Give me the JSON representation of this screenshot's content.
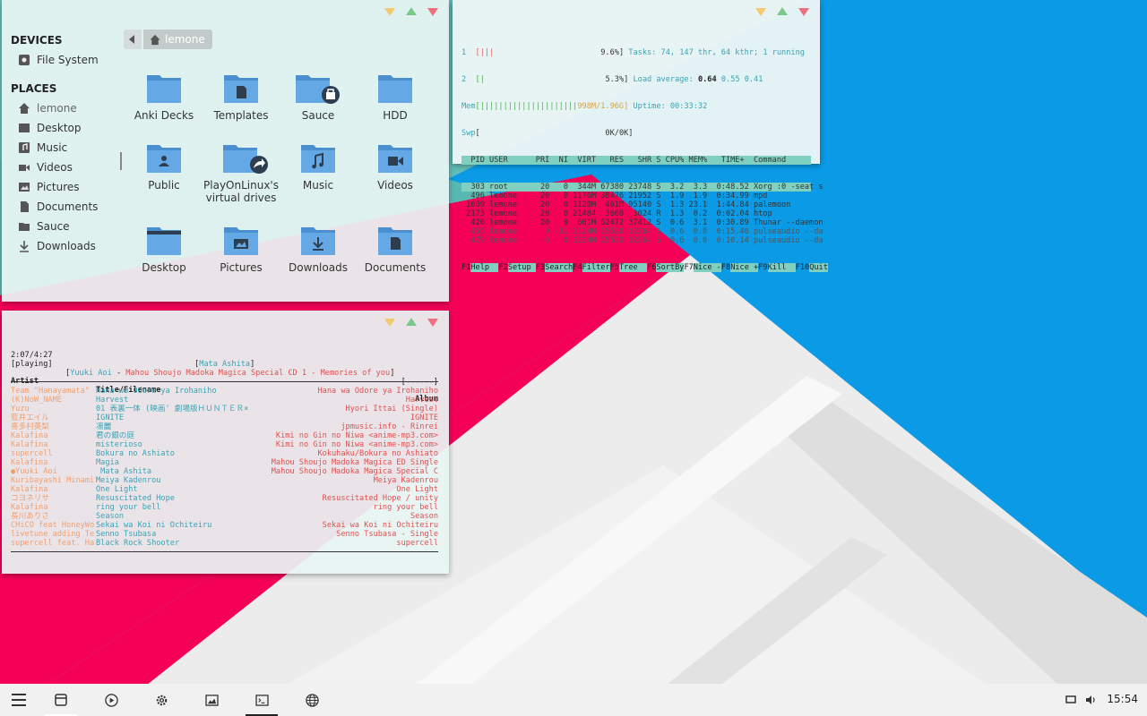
{
  "colors": {
    "accent_pink": "#f50057",
    "accent_blue": "#0a9ae6",
    "teal": "#5ab8b3",
    "term_header": "#7fd0c0"
  },
  "file_manager": {
    "sidebar": {
      "devices_title": "DEVICES",
      "devices": [
        {
          "label": "File System",
          "icon": "drive-icon"
        }
      ],
      "places_title": "PLACES",
      "places": [
        {
          "label": "lemone",
          "icon": "home-icon"
        },
        {
          "label": "Desktop",
          "icon": "desktop-icon"
        },
        {
          "label": "Music",
          "icon": "music-icon"
        },
        {
          "label": "Videos",
          "icon": "video-icon"
        },
        {
          "label": "Pictures",
          "icon": "pictures-icon"
        },
        {
          "label": "Documents",
          "icon": "documents-icon"
        },
        {
          "label": "Sauce",
          "icon": "folder-icon"
        },
        {
          "label": "Downloads",
          "icon": "download-icon"
        }
      ]
    },
    "path": {
      "current": "lemone"
    },
    "items": [
      {
        "label": "Anki Decks",
        "icon": "folder-icon"
      },
      {
        "label": "Templates",
        "icon": "templates-folder-icon"
      },
      {
        "label": "Sauce",
        "icon": "shared-folder-icon"
      },
      {
        "label": "HDD",
        "icon": "folder-icon"
      },
      {
        "label": "Public",
        "icon": "public-folder-icon"
      },
      {
        "label": "PlayOnLinux's virtual drives",
        "icon": "symlink-folder-icon"
      },
      {
        "label": "Music",
        "icon": "music-folder-icon"
      },
      {
        "label": "Videos",
        "icon": "videos-folder-icon"
      },
      {
        "label": "Desktop",
        "icon": "desktop-folder-icon"
      },
      {
        "label": "Pictures",
        "icon": "pictures-folder-icon"
      },
      {
        "label": "Downloads",
        "icon": "downloads-folder-icon"
      },
      {
        "label": "Documents",
        "icon": "documents-folder-icon"
      }
    ]
  },
  "htop": {
    "cpu1": {
      "label": "1",
      "bar": "[|||",
      "pct": "9.6%]"
    },
    "cpu2": {
      "label": "2",
      "bar": "[|",
      "pct": "5.3%]"
    },
    "mem": {
      "label": "Mem",
      "bar": "[|||||||||||||||||||||",
      "value": "998M/1.96G]"
    },
    "swp": {
      "label": "Swp",
      "bar": "[",
      "value": "0K/0K]"
    },
    "tasks": "Tasks: 74, 147 thr, 64 kthr; 1 running",
    "load_label": "Load average:",
    "load_1": "0.64",
    "load_rest": "0.55 0.41",
    "uptime": "Uptime: 00:33:32",
    "columns": "  PID USER      PRI  NI  VIRT   RES   SHR S CPU% MEM%   TIME+  Command",
    "rows": [
      "  303 root       20   0  344M 67380 23748 S  3.2  3.3  0:48.52 Xorg :0 -seat s",
      "  496 lemone     20   0 1176M 38476 21952 S  1.9  1.9  0:34.99 mpd",
      " 1609 lemone     20   0 1120M  461M 95140 S  1.3 23.1  1:44.84 palemoon",
      " 2173 lemone     20   0 21484  3660  3024 R  1.3  0.2  0:02.04 htop",
      "  426 lemone     20   0  601M 62472 37412 S  0.6  3.1  0:30.89 Thunar --daemon",
      "  455 lemone      9 -11 1124M 15520 12264 S  0.6  0.8  0:15.46 pulseaudio --da",
      "  479 lemone     -6   0 1124M 15520 12264 S  0.6  0.8  0:10.14 pulseaudio --da"
    ],
    "fkeys": [
      {
        "k": "F1",
        "v": "Help  "
      },
      {
        "k": "F2",
        "v": "Setup "
      },
      {
        "k": "F3",
        "v": "Search"
      },
      {
        "k": "F4",
        "v": "Filter"
      },
      {
        "k": "F5",
        "v": "Tree  "
      },
      {
        "k": "F6",
        "v": "SortBy"
      },
      {
        "k": "F7",
        "v": "Nice -"
      },
      {
        "k": "F8",
        "v": "Nice +"
      },
      {
        "k": "F9",
        "v": "Kill  "
      },
      {
        "k": "F10",
        "v": "Quit"
      }
    ]
  },
  "cmus": {
    "time": "2:07/4:27",
    "status": "[playing]",
    "title_center": "Mata Ashita",
    "now_artist": "Yuuki Aoi",
    "now_dash": " - ",
    "now_album": "Mahou Shoujo Madoka Magica Special CD 1 - Memories of you",
    "flags": "[------]",
    "head_artist": "Artist",
    "head_title": "Title/Filename",
    "head_album": "Album",
    "rows": [
      {
        "a": "Team \"Hanayamata\"",
        "t": "Hana wa Odore ya Irohaniho",
        "al": "Hana wa Odore ya Irohaniho"
      },
      {
        "a": "(K)NoW_NAME",
        "t": "Harvest",
        "al": "Harvest"
      },
      {
        "a": "Yuzu",
        "t": "01 表裏一体 (映画' 劇場版ＨＵＮＴＥＲ×",
        "al": "Hyori Ittai (Single)"
      },
      {
        "a": "藍井エイル",
        "t": "IGNITE",
        "al": "IGNITE"
      },
      {
        "a": "喜多村英梨",
        "t": "凛麗",
        "al": "jpmusic.info - Rinrei"
      },
      {
        "a": "Kalafina",
        "t": "君の銀の庭",
        "al": "Kimi no Gin no Niwa <anime-mp3.com>"
      },
      {
        "a": "Kalafina",
        "t": "misterioso",
        "al": "Kimi no Gin no Niwa <anime-mp3.com>"
      },
      {
        "a": "supercell",
        "t": "Bokura no Ashiato",
        "al": "Kokuhaku/Bokura no Ashiato"
      },
      {
        "a": "Kalafina",
        "t": "Magia",
        "al": "Mahou Shoujo Madoka Magica ED Single"
      },
      {
        "a": "●Yuuki Aoi",
        "t": " Mata Ashita",
        "al": "Mahou Shoujo Madoka Magica Special C",
        "cur": true
      },
      {
        "a": "Kuribayashi Minami",
        "t": "Meiya Kadenrou",
        "al": "Meiya Kadenrou"
      },
      {
        "a": "Kalafina",
        "t": "One Light",
        "al": "One Light"
      },
      {
        "a": "コヨネリサ",
        "t": "Resuscitated Hope",
        "al": "Resuscitated Hope / unity"
      },
      {
        "a": "Kalafina",
        "t": "ring your bell",
        "al": "ring your bell"
      },
      {
        "a": "長川ありさ",
        "t": "Season",
        "al": "Season"
      },
      {
        "a": "CHiCO feat HoneyWo",
        "t": "Sekai wa Koi ni Ochiteiru",
        "al": "Sekai wa Koi ni Ochiteiru"
      },
      {
        "a": "livetune adding Te",
        "t": "Senno Tsubasa",
        "al": "Senno Tsubasa - Single"
      },
      {
        "a": "supercell feat. Ha",
        "t": "Black Rock Shooter",
        "al": "supercell"
      }
    ]
  },
  "taskbar": {
    "clock": "15:54",
    "icons": [
      "menu-icon",
      "files-icon",
      "media-player-icon",
      "settings-icon",
      "image-viewer-icon",
      "terminal-icon",
      "web-browser-icon"
    ],
    "tray": [
      "display-icon",
      "volume-icon"
    ]
  }
}
